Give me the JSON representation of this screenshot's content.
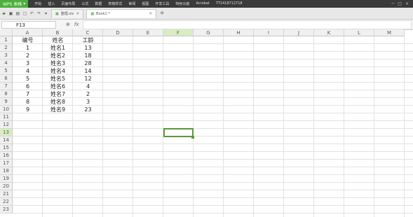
{
  "app": {
    "menu_label": "WPS 表格",
    "caret": "▾"
  },
  "menu": [
    "开始",
    "插入",
    "页面布局",
    "公式",
    "数据",
    "表格样式",
    "审阅",
    "视图",
    "开发工具",
    "特色功能",
    "Acrobat",
    "TT1418712718"
  ],
  "tabs": [
    {
      "label": "整理.xls",
      "active": false
    },
    {
      "label": "Book1 *",
      "active": true
    }
  ],
  "name_box": "F13",
  "fx": "fx",
  "columns": [
    "A",
    "B",
    "C",
    "D",
    "E",
    "F",
    "G",
    "H",
    "I",
    "J",
    "K",
    "L",
    "M"
  ],
  "selected_col": "F",
  "selected_row": 13,
  "rows": [
    1,
    2,
    3,
    4,
    5,
    6,
    7,
    8,
    9,
    10,
    11,
    12,
    13,
    14,
    15,
    16,
    17,
    18,
    19,
    20,
    21,
    22,
    23
  ],
  "sheet": {
    "headers": [
      "编号",
      "姓名",
      "工龄"
    ],
    "records": [
      [
        "1",
        "姓名1",
        "13"
      ],
      [
        "2",
        "姓名2",
        "18"
      ],
      [
        "3",
        "姓名3",
        "28"
      ],
      [
        "4",
        "姓名4",
        "14"
      ],
      [
        "5",
        "姓名5",
        "12"
      ],
      [
        "6",
        "姓名6",
        "4"
      ],
      [
        "7",
        "姓名7",
        "2"
      ],
      [
        "8",
        "姓名8",
        "3"
      ],
      [
        "9",
        "姓名9",
        "23"
      ]
    ]
  }
}
